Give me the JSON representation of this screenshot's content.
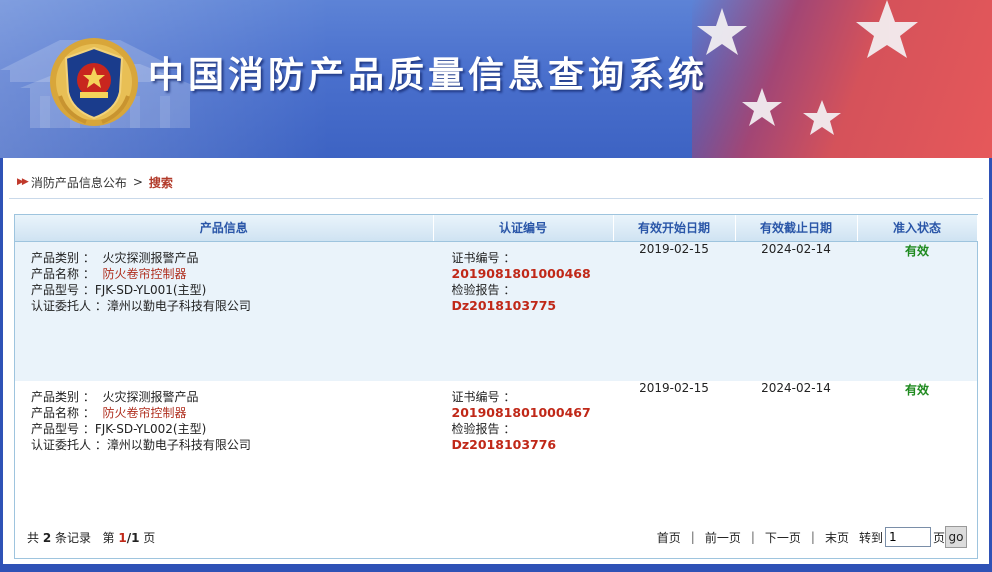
{
  "header": {
    "title": "中国消防产品质量信息查询系统"
  },
  "breadcrumb": {
    "parent": "消防产品信息公布",
    "separator": ">",
    "current": "搜索"
  },
  "table": {
    "columns": [
      "产品信息",
      "认证编号",
      "有效开始日期",
      "有效截止日期",
      "准入状态"
    ],
    "labels": {
      "category": "产品类别 ：",
      "name": "产品名称 ：",
      "model": "产品型号 ：",
      "client": "认证委托人 ：",
      "cert_no": "证书编号 ：",
      "report_no": "检验报告 ："
    },
    "rows": [
      {
        "category": "火灾探测报警产品",
        "name": "防火卷帘控制器",
        "model": "FJK-SD-YL001(主型)",
        "client": "漳州以勤电子科技有限公司",
        "cert_no": "2019081801000468",
        "report_no": "Dz2018103775",
        "start_date": "2019-02-15",
        "end_date": "2024-02-14",
        "status": "有效"
      },
      {
        "category": "火灾探测报警产品",
        "name": "防火卷帘控制器",
        "model": "FJK-SD-YL002(主型)",
        "client": "漳州以勤电子科技有限公司",
        "cert_no": "2019081801000467",
        "report_no": "Dz2018103776",
        "start_date": "2019-02-15",
        "end_date": "2024-02-14",
        "status": "有效"
      }
    ]
  },
  "pager": {
    "total_prefix": "共",
    "total": "2",
    "total_suffix": "条记录",
    "page_prefix": "第",
    "current_page": "1",
    "page_sep": "/",
    "total_pages": "1",
    "page_suffix": "页",
    "first": "首页",
    "prev": "前一页",
    "next": "下一页",
    "last": "末页",
    "goto_prefix": "转到",
    "goto_value": "1",
    "goto_suffix": "页",
    "go_label": "go",
    "divider": "|"
  },
  "colors": {
    "accent_blue": "#2a56a8",
    "cert_red": "#c02818",
    "status_green": "#1f8a1f",
    "frame_blue": "#2f52b6"
  },
  "icons": {
    "emblem": "police-emblem-icon",
    "breadcrumb_arrows": "double-arrow-icon"
  }
}
